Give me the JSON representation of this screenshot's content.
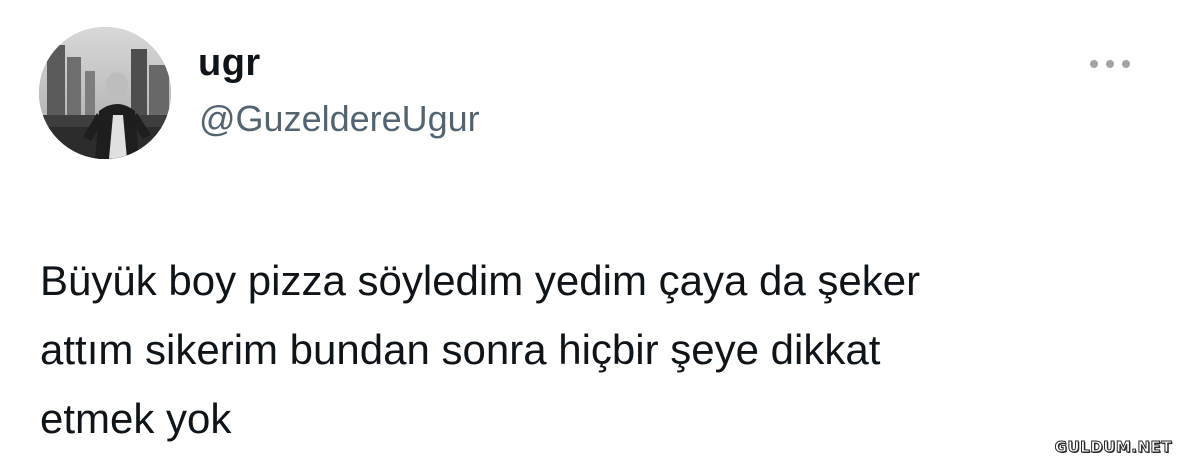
{
  "tweet": {
    "author": {
      "display_name": "ugr",
      "handle": "@GuzeldereUgur",
      "avatar": "profile-photo"
    },
    "more_icon": "more-horizontal-icon",
    "text_lines": [
      "Büyük boy pizza söyledim yedim çaya da şeker",
      "attım sikerim bundan sonra hiçbir şeye dikkat",
      "etmek yok"
    ]
  },
  "watermark": "GULDUM.NET",
  "colors": {
    "text": "#0f1419",
    "secondary_text": "#536471",
    "background": "#ffffff"
  }
}
